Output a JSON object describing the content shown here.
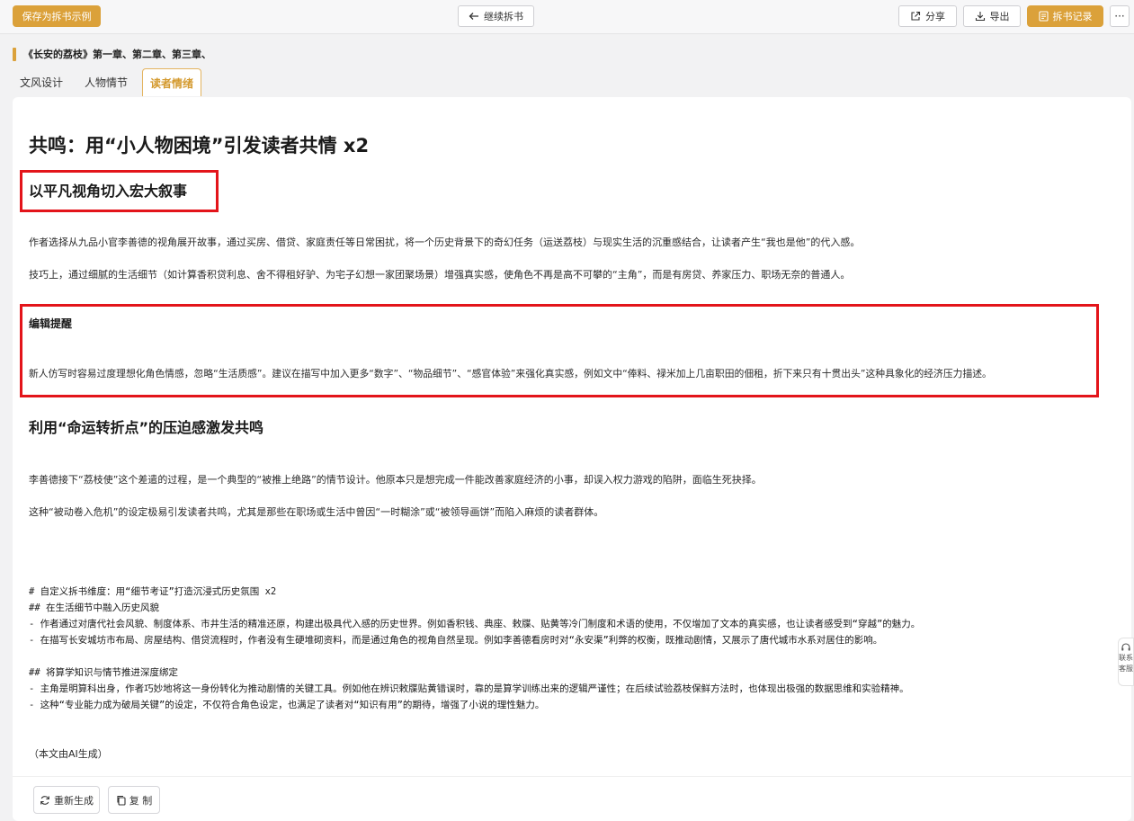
{
  "toolbar": {
    "save_label": "保存为拆书示例",
    "continue_label": "继续拆书",
    "share_label": "分享",
    "export_label": "导出",
    "records_label": "拆书记录",
    "more_label": "···"
  },
  "book": {
    "title": "《长安的荔枝》第一章、第二章、第三章、"
  },
  "tabs": [
    {
      "label": "文风设计"
    },
    {
      "label": "人物情节"
    },
    {
      "label": "读者情绪"
    }
  ],
  "content": {
    "h1": "共鸣：用“小人物困境”引发读者共情 x2",
    "section1": {
      "title": "以平凡视角切入宏大叙事",
      "p1": "作者选择从九品小官李善德的视角展开故事，通过买房、借贷、家庭责任等日常困扰，将一个历史背景下的奇幻任务（运送荔枝）与现实生活的沉重感结合，让读者产生“我也是他”的代入感。",
      "p2": "技巧上，通过细腻的生活细节（如计算香积贷利息、舍不得租好驴、为宅子幻想一家团聚场景）增强真实感，使角色不再是高不可攀的“主角”，而是有房贷、养家压力、职场无奈的普通人。"
    },
    "editor_note": {
      "title": "编辑提醒",
      "text": "新人仿写时容易过度理想化角色情感，忽略“生活质感”。建议在描写中加入更多“数字”、“物品细节”、“感官体验”来强化真实感，例如文中“俸料、禄米加上几亩职田的佃租，折下来只有十贯出头”这种具象化的经济压力描述。"
    },
    "section2": {
      "title": "利用“命运转折点”的压迫感激发共鸣",
      "p1": "李善德接下“荔枝使”这个差遣的过程，是一个典型的“被推上绝路”的情节设计。他原本只是想完成一件能改善家庭经济的小事，却误入权力游戏的陷阱，面临生死抉择。",
      "p2": "这种“被动卷入危机”的设定极易引发读者共鸣，尤其是那些在职场或生活中曾因“一时糊涂”或“被领导画饼”而陷入麻烦的读者群体。"
    },
    "markdown": [
      "# 自定义拆书维度：用“细节考证”打造沉浸式历史氛围 x2",
      "## 在生活细节中融入历史风貌",
      "- 作者通过对唐代社会风貌、制度体系、市井生活的精准还原，构建出极具代入感的历史世界。例如香积钱、典座、敕牒、贴黄等冷门制度和术语的使用，不仅增加了文本的真实感，也让读者感受到“穿越”的魅力。",
      "- 在描写长安城坊市布局、房屋结构、借贷流程时，作者没有生硬堆砌资料，而是通过角色的视角自然呈现。例如李善德看房时对“永安渠”利弊的权衡，既推动剧情，又展示了唐代城市水系对居住的影响。",
      "## 将算学知识与情节推进深度绑定",
      "- 主角是明算科出身，作者巧妙地将这一身份转化为推动剧情的关键工具。例如他在辨识敕牒贴黄错误时，靠的是算学训练出来的逻辑严谨性；在后续试验荔枝保鲜方法时，也体现出极强的数据思维和实验精神。",
      "- 这种“专业能力成为破局关键”的设定，不仅符合角色设定，也满足了读者对“知识有用”的期待，增强了小说的理性魅力。"
    ],
    "ai_note": "（本文由AI生成）"
  },
  "actions": {
    "regenerate_label": "重新生成",
    "copy_label": "复 制"
  },
  "side_widget": {
    "line1": "联系",
    "line2": "客服"
  },
  "colors": {
    "accent": "#dba13a",
    "highlight_box": "#e3141a"
  }
}
